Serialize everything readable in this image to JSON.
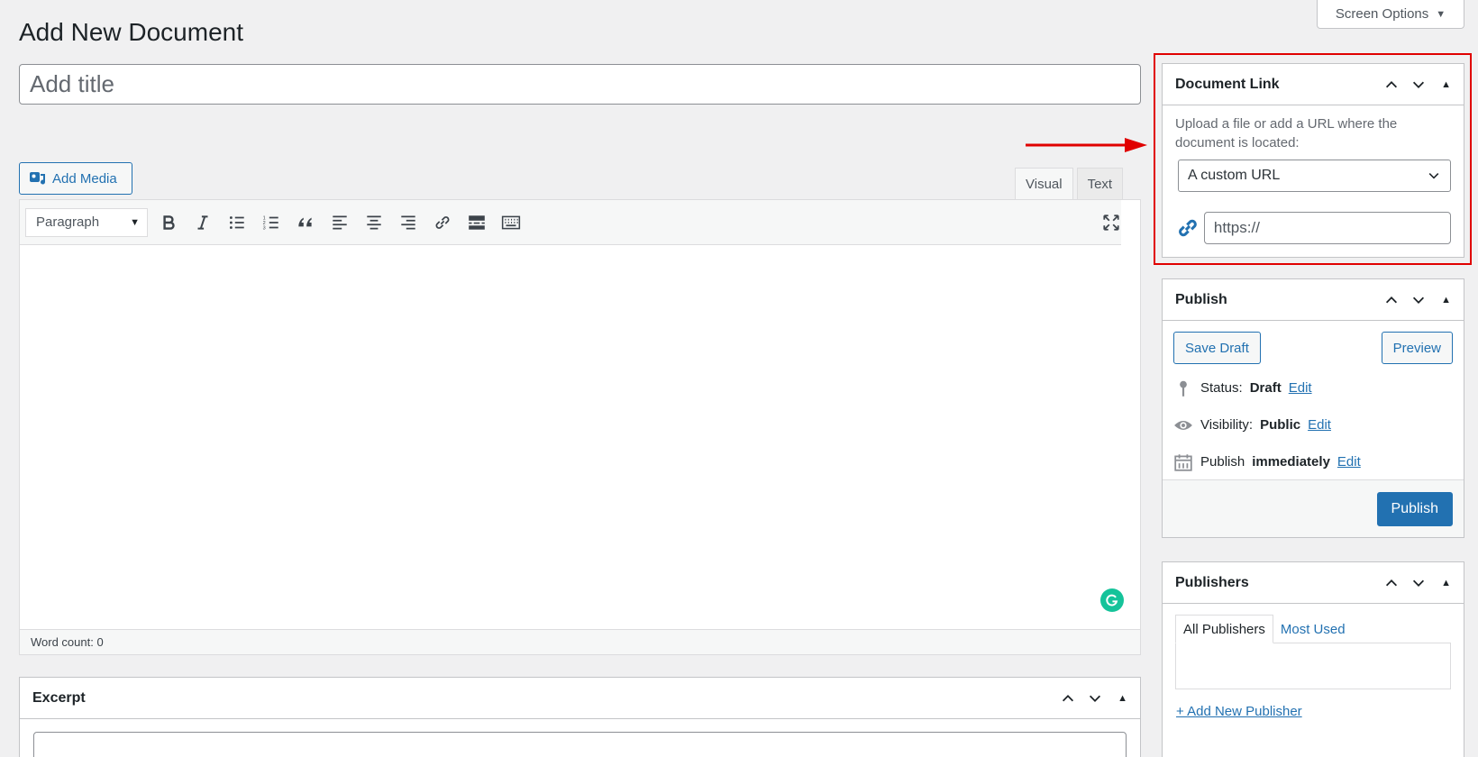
{
  "screen_options": {
    "label": "Screen Options"
  },
  "page": {
    "title": "Add New Document"
  },
  "title_input": {
    "placeholder": "Add title"
  },
  "editor": {
    "add_media_label": "Add Media",
    "tabs": {
      "visual": "Visual",
      "text": "Text"
    },
    "format_select": "Paragraph",
    "word_count": "Word count: 0"
  },
  "excerpt": {
    "title": "Excerpt"
  },
  "document_link": {
    "title": "Document Link",
    "description": "Upload a file or add a URL where the document is located:",
    "select_value": "A custom URL",
    "url_placeholder": "https://"
  },
  "publish": {
    "title": "Publish",
    "save_draft": "Save Draft",
    "preview": "Preview",
    "status_label": "Status:",
    "status_value": "Draft",
    "visibility_label": "Visibility:",
    "visibility_value": "Public",
    "schedule_label": "Publish",
    "schedule_value": "immediately",
    "edit_label": "Edit",
    "publish_button": "Publish"
  },
  "publishers": {
    "title": "Publishers",
    "tab_all": "All Publishers",
    "tab_most_used": "Most Used",
    "add_new": "+ Add New Publisher"
  },
  "colors": {
    "accent": "#2271b1",
    "highlight": "#e00000",
    "grammarly": "#15c39a"
  }
}
